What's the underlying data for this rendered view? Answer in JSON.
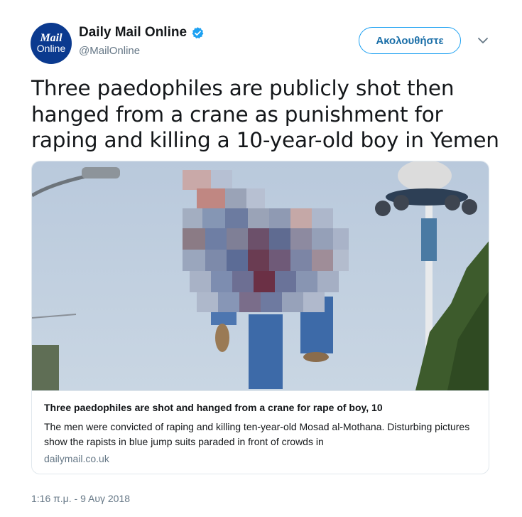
{
  "author": {
    "avatar_line1": "Mail",
    "avatar_line2": "Online",
    "display_name": "Daily Mail Online",
    "handle": "@MailOnline",
    "verified": true
  },
  "actions": {
    "follow_label": "Ακολουθήστε",
    "menu_icon": "chevron-down-icon"
  },
  "tweet": {
    "text": "Three paedophiles are publicly shot then hanged from a crane as punishment for raping and killing a 10-year-old boy in Yemen",
    "timestamp": "1:16 π.μ. - 9 Αυγ 2018"
  },
  "card": {
    "title": "Three paedophiles are shot and hanged from a crane for rape of boy, 10",
    "description": "The men were convicted of raping and killing ten-year-old Mosad al-Mothana. Disturbing pictures show the rapists in blue jump suits paraded in front of crowds in",
    "domain": "dailymail.co.uk",
    "image_note": "pixelated"
  },
  "colors": {
    "accent": "#1da1f2",
    "text": "#14171a",
    "muted": "#657786",
    "border": "#e1e8ed",
    "avatar_bg": "#0b3a8f"
  }
}
